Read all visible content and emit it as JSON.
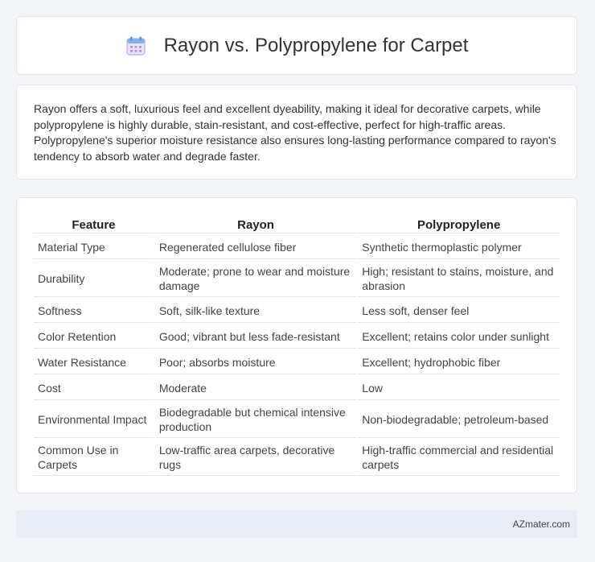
{
  "header": {
    "title": "Rayon vs. Polypropylene for Carpet",
    "icon": "calendar-icon"
  },
  "description": "Rayon offers a soft, luxurious feel and excellent dyeability, making it ideal for decorative carpets, while polypropylene is highly durable, stain-resistant, and cost-effective, perfect for high-traffic areas. Polypropylene's superior moisture resistance also ensures long-lasting performance compared to rayon's tendency to absorb water and degrade faster.",
  "table": {
    "headers": [
      "Feature",
      "Rayon",
      "Polypropylene"
    ],
    "rows": [
      [
        "Material Type",
        "Regenerated cellulose fiber",
        "Synthetic thermoplastic polymer"
      ],
      [
        "Durability",
        "Moderate; prone to wear and moisture damage",
        "High; resistant to stains, moisture, and abrasion"
      ],
      [
        "Softness",
        "Soft, silk-like texture",
        "Less soft, denser feel"
      ],
      [
        "Color Retention",
        "Good; vibrant but less fade-resistant",
        "Excellent; retains color under sunlight"
      ],
      [
        "Water Resistance",
        "Poor; absorbs moisture",
        "Excellent; hydrophobic fiber"
      ],
      [
        "Cost",
        "Moderate",
        "Low"
      ],
      [
        "Environmental Impact",
        "Biodegradable but chemical intensive production",
        "Non-biodegradable; petroleum-based"
      ],
      [
        "Common Use in Carpets",
        "Low-traffic area carpets, decorative rugs",
        "High-traffic commercial and residential carpets"
      ]
    ]
  },
  "footer": {
    "brand": "AZmater.com"
  }
}
